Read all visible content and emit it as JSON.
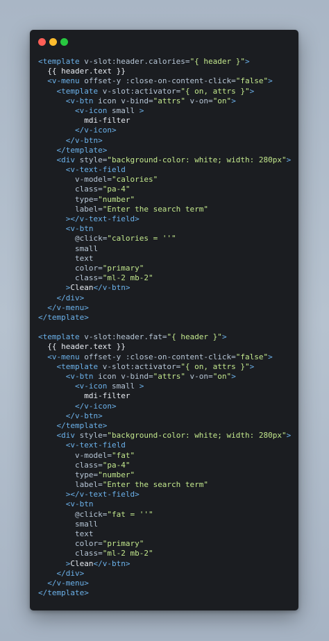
{
  "colors": {
    "tag": "#6cb2eb",
    "attr": "#b7c6d6",
    "string": "#c3e88d",
    "text": "#e8ecf2",
    "plain": "#cdd3de",
    "window_bg": "#1b1d21"
  },
  "window_controls": [
    "close",
    "minimize",
    "zoom"
  ],
  "lines": [
    [
      [
        "tag",
        "<template "
      ],
      [
        "attr",
        "v-slot:header.calories="
      ],
      [
        "str",
        "\"{ header }\""
      ],
      [
        "tag",
        ">"
      ]
    ],
    [
      [
        "text",
        "  {{ header.text }}"
      ]
    ],
    [
      [
        "tag",
        "  <v-menu "
      ],
      [
        "attr",
        "offset-y :close-on-content-click="
      ],
      [
        "str",
        "\"false\""
      ],
      [
        "tag",
        ">"
      ]
    ],
    [
      [
        "tag",
        "    <template "
      ],
      [
        "attr",
        "v-slot:activator="
      ],
      [
        "str",
        "\"{ on, attrs }\""
      ],
      [
        "tag",
        ">"
      ]
    ],
    [
      [
        "tag",
        "      <v-btn "
      ],
      [
        "attr",
        "icon v-bind="
      ],
      [
        "str",
        "\"attrs\""
      ],
      [
        "attr",
        " v-on="
      ],
      [
        "str",
        "\"on\""
      ],
      [
        "tag",
        ">"
      ]
    ],
    [
      [
        "tag",
        "        <v-icon "
      ],
      [
        "attr",
        "small "
      ],
      [
        "tag",
        ">"
      ]
    ],
    [
      [
        "text",
        "          mdi-filter"
      ]
    ],
    [
      [
        "tag",
        "        </v-icon>"
      ]
    ],
    [
      [
        "tag",
        "      </v-btn>"
      ]
    ],
    [
      [
        "tag",
        "    </template>"
      ]
    ],
    [
      [
        "tag",
        "    <div "
      ],
      [
        "attr",
        "style="
      ],
      [
        "str",
        "\"background-color: white; width: 280px\""
      ],
      [
        "tag",
        ">"
      ]
    ],
    [
      [
        "tag",
        "      <v-text-field"
      ]
    ],
    [
      [
        "attr",
        "        v-model="
      ],
      [
        "str",
        "\"calories\""
      ]
    ],
    [
      [
        "attr",
        "        class="
      ],
      [
        "str",
        "\"pa-4\""
      ]
    ],
    [
      [
        "attr",
        "        type="
      ],
      [
        "str",
        "\"number\""
      ]
    ],
    [
      [
        "attr",
        "        label="
      ],
      [
        "str",
        "\"Enter the search term\""
      ]
    ],
    [
      [
        "tag",
        "      ></v-text-field>"
      ]
    ],
    [
      [
        "tag",
        "      <v-btn"
      ]
    ],
    [
      [
        "attr",
        "        @click="
      ],
      [
        "str",
        "\"calories = ''\""
      ]
    ],
    [
      [
        "attr",
        "        small"
      ]
    ],
    [
      [
        "attr",
        "        text"
      ]
    ],
    [
      [
        "attr",
        "        color="
      ],
      [
        "str",
        "\"primary\""
      ]
    ],
    [
      [
        "attr",
        "        class="
      ],
      [
        "str",
        "\"ml-2 mb-2\""
      ]
    ],
    [
      [
        "tag",
        "      >"
      ],
      [
        "text",
        "Clean"
      ],
      [
        "tag",
        "</v-btn>"
      ]
    ],
    [
      [
        "tag",
        "    </div>"
      ]
    ],
    [
      [
        "tag",
        "  </v-menu>"
      ]
    ],
    [
      [
        "tag",
        "</template>"
      ]
    ],
    [
      [
        "plain",
        ""
      ]
    ],
    [
      [
        "tag",
        "<template "
      ],
      [
        "attr",
        "v-slot:header.fat="
      ],
      [
        "str",
        "\"{ header }\""
      ],
      [
        "tag",
        ">"
      ]
    ],
    [
      [
        "text",
        "  {{ header.text }}"
      ]
    ],
    [
      [
        "tag",
        "  <v-menu "
      ],
      [
        "attr",
        "offset-y :close-on-content-click="
      ],
      [
        "str",
        "\"false\""
      ],
      [
        "tag",
        ">"
      ]
    ],
    [
      [
        "tag",
        "    <template "
      ],
      [
        "attr",
        "v-slot:activator="
      ],
      [
        "str",
        "\"{ on, attrs }\""
      ],
      [
        "tag",
        ">"
      ]
    ],
    [
      [
        "tag",
        "      <v-btn "
      ],
      [
        "attr",
        "icon v-bind="
      ],
      [
        "str",
        "\"attrs\""
      ],
      [
        "attr",
        " v-on="
      ],
      [
        "str",
        "\"on\""
      ],
      [
        "tag",
        ">"
      ]
    ],
    [
      [
        "tag",
        "        <v-icon "
      ],
      [
        "attr",
        "small "
      ],
      [
        "tag",
        ">"
      ]
    ],
    [
      [
        "text",
        "          mdi-filter"
      ]
    ],
    [
      [
        "tag",
        "        </v-icon>"
      ]
    ],
    [
      [
        "tag",
        "      </v-btn>"
      ]
    ],
    [
      [
        "tag",
        "    </template>"
      ]
    ],
    [
      [
        "tag",
        "    <div "
      ],
      [
        "attr",
        "style="
      ],
      [
        "str",
        "\"background-color: white; width: 280px\""
      ],
      [
        "tag",
        ">"
      ]
    ],
    [
      [
        "tag",
        "      <v-text-field"
      ]
    ],
    [
      [
        "attr",
        "        v-model="
      ],
      [
        "str",
        "\"fat\""
      ]
    ],
    [
      [
        "attr",
        "        class="
      ],
      [
        "str",
        "\"pa-4\""
      ]
    ],
    [
      [
        "attr",
        "        type="
      ],
      [
        "str",
        "\"number\""
      ]
    ],
    [
      [
        "attr",
        "        label="
      ],
      [
        "str",
        "\"Enter the search term\""
      ]
    ],
    [
      [
        "tag",
        "      ></v-text-field>"
      ]
    ],
    [
      [
        "tag",
        "      <v-btn"
      ]
    ],
    [
      [
        "attr",
        "        @click="
      ],
      [
        "str",
        "\"fat = ''\""
      ]
    ],
    [
      [
        "attr",
        "        small"
      ]
    ],
    [
      [
        "attr",
        "        text"
      ]
    ],
    [
      [
        "attr",
        "        color="
      ],
      [
        "str",
        "\"primary\""
      ]
    ],
    [
      [
        "attr",
        "        class="
      ],
      [
        "str",
        "\"ml-2 mb-2\""
      ]
    ],
    [
      [
        "tag",
        "      >"
      ],
      [
        "text",
        "Clean"
      ],
      [
        "tag",
        "</v-btn>"
      ]
    ],
    [
      [
        "tag",
        "    </div>"
      ]
    ],
    [
      [
        "tag",
        "  </v-menu>"
      ]
    ],
    [
      [
        "tag",
        "</template>"
      ]
    ]
  ]
}
